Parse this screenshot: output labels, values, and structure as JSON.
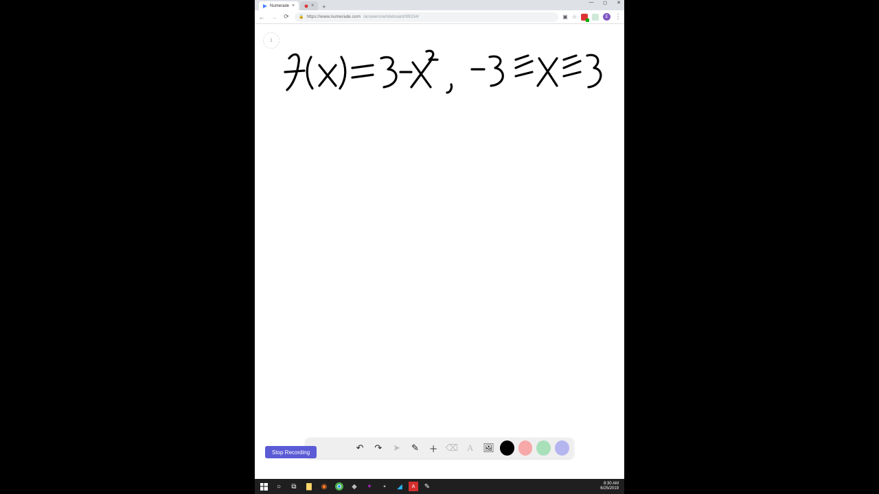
{
  "browser": {
    "tabs": [
      {
        "title": "Numerade",
        "active": true
      },
      {
        "title": "",
        "active": false
      }
    ],
    "url_prefix": "https://www.numerade.com",
    "url_suffix": "/answers/whiteboard/99334/",
    "avatar_initial": "E"
  },
  "whiteboard": {
    "page_indicator": "1",
    "handwriting": "f(x) = 3 − x² ,  −3 ≤ x ≤ 3",
    "record_button": "Stop Recording",
    "tools": {
      "undo": "↶",
      "redo": "↷",
      "pointer": "➤",
      "pen": "✎",
      "add": "＋",
      "eraser": "⌫",
      "text": "A",
      "image": "🖼"
    },
    "swatches": [
      "#000000",
      "#f7a8a8",
      "#a8e0b9",
      "#b5b5f0"
    ]
  },
  "taskbar": {
    "time": "8:30 AM",
    "date": "6/25/2019"
  }
}
